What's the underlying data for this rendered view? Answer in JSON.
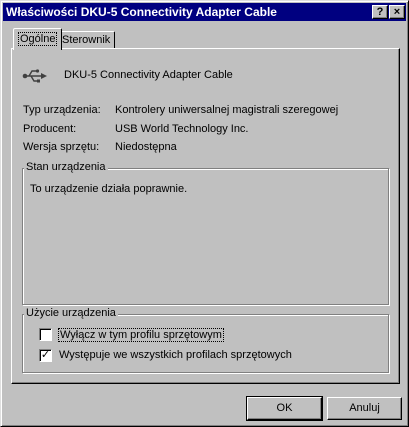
{
  "window": {
    "title": "Właściwości DKU-5 Connectivity Adapter Cable",
    "help_label": "?",
    "close_label": "×"
  },
  "tabs": [
    {
      "label": "Ogólne",
      "active": true
    },
    {
      "label": "Sterownik",
      "active": false
    }
  ],
  "device": {
    "icon": "usb-icon",
    "name": "DKU-5 Connectivity Adapter Cable"
  },
  "properties": [
    {
      "label": "Typ urządzenia:",
      "value": "Kontrolery uniwersalnej magistrali szeregowej"
    },
    {
      "label": "Producent:",
      "value": "USB World Technology Inc."
    },
    {
      "label": "Wersja sprzętu:",
      "value": "Niedostępna"
    }
  ],
  "status": {
    "title": "Stan urządzenia",
    "text": "To urządzenie działa poprawnie."
  },
  "usage": {
    "title": "Użycie urządzenia",
    "options": [
      {
        "label": "Wyłącz w tym profilu sprzętowym",
        "checked": false
      },
      {
        "label": "Występuje we wszystkich profilach sprzętowych",
        "checked": true
      }
    ]
  },
  "buttons": {
    "ok": "OK",
    "cancel": "Anuluj"
  }
}
